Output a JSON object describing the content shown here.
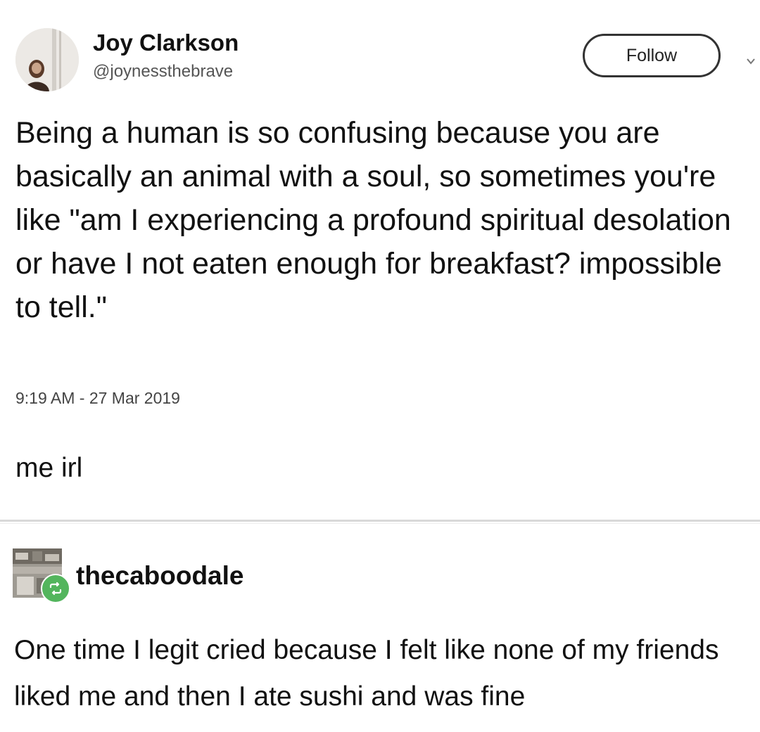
{
  "tweet": {
    "author_name": "Joy Clarkson",
    "author_handle": "@joynessthebrave",
    "follow_label": "Follow",
    "text": "Being a human is so confusing because you are basically an animal with a soul, so sometimes you're like \"am I experiencing a profound spiritual desolation or have I not eaten enough for breakfast? impossible to tell.\"",
    "timestamp": "9:19 AM - 27 Mar 2019"
  },
  "post": {
    "caption": "me irl"
  },
  "reblog": {
    "username": "thecaboodale",
    "text": "One time I legit cried because I felt like none of my friends liked me and then I ate sushi and was fine",
    "badge_icon": "reblog-icon",
    "badge_color": "#53b55d"
  }
}
